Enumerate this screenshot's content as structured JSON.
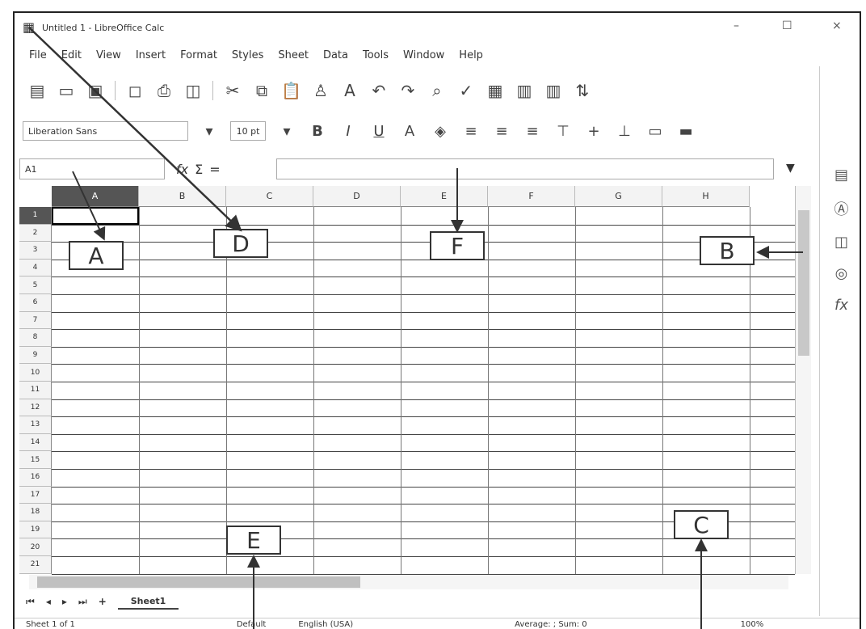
{
  "window": {
    "title": "Untitled 1 - LibreOffice Calc",
    "controls": [
      "–",
      "☐",
      "×"
    ]
  },
  "menu": [
    "File",
    "Edit",
    "View",
    "Insert",
    "Format",
    "Styles",
    "Sheet",
    "Data",
    "Tools",
    "Window",
    "Help"
  ],
  "toolbar": {
    "font_name": "Liberation Sans",
    "font_size": "10 pt"
  },
  "formula_bar": {
    "name_box": "A1",
    "input_value": ""
  },
  "grid": {
    "columns": [
      "A",
      "B",
      "C",
      "D",
      "E",
      "F",
      "G",
      "H"
    ],
    "rows": [
      "1",
      "2",
      "3",
      "4",
      "5",
      "6",
      "7",
      "8",
      "9",
      "10",
      "11",
      "12",
      "13",
      "14",
      "15",
      "16",
      "17",
      "18",
      "19",
      "20",
      "21"
    ],
    "selected_cell": "A1"
  },
  "sheet_tabs": {
    "tabs": [
      "Sheet1"
    ],
    "active": "Sheet1"
  },
  "status_bar": {
    "sheet": "Sheet 1 of 1",
    "style": "Default",
    "language": "English (USA)",
    "summary": "Average: ; Sum: 0",
    "zoom": "100%"
  },
  "callouts": [
    "A",
    "B",
    "C",
    "D",
    "E",
    "F"
  ]
}
